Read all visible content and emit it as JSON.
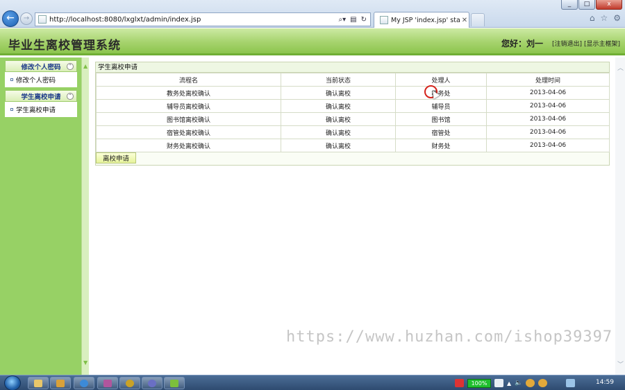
{
  "browser": {
    "url": "http://localhost:8080/lxglxt/admin/index.jsp",
    "tab_title": "My JSP 'index.jsp' startin...",
    "window_buttons": {
      "minimize": "_",
      "maximize": "□",
      "close": "x"
    }
  },
  "header": {
    "title": "毕业生离校管理系统",
    "greeting": "您好：刘一",
    "links": [
      "[注销退出]",
      "[显示主框架]"
    ]
  },
  "sidebar": {
    "groups": [
      {
        "title": "修改个人密码",
        "items": [
          "修改个人密码"
        ]
      },
      {
        "title": "学生离校申请",
        "items": [
          "学生离校申请"
        ]
      }
    ]
  },
  "panel": {
    "title": "学生离校申请",
    "columns": [
      "流程名",
      "当前状态",
      "处理人",
      "处理时间"
    ],
    "rows": [
      [
        "教务处离校确认",
        "确认离校",
        "教务处",
        "2013-04-06"
      ],
      [
        "辅导员离校确认",
        "确认离校",
        "辅导员",
        "2013-04-06"
      ],
      [
        "图书馆离校确认",
        "确认离校",
        "图书馆",
        "2013-04-06"
      ],
      [
        "宿管处离校确认",
        "确认离校",
        "宿管处",
        "2013-04-06"
      ],
      [
        "财务处离校确认",
        "确认离校",
        "财务处",
        "2013-04-06"
      ]
    ],
    "apply_button": "离校申请"
  },
  "watermark": "https://www.huzhan.com/ishop39397",
  "taskbar": {
    "battery": "100%",
    "clock": "14:59"
  },
  "colors": {
    "header_green": "#a6d36d",
    "sidebar_green": "#97d165",
    "menu_text_blue": "#1c3a8a",
    "cursor_ring": "#d4221a"
  }
}
